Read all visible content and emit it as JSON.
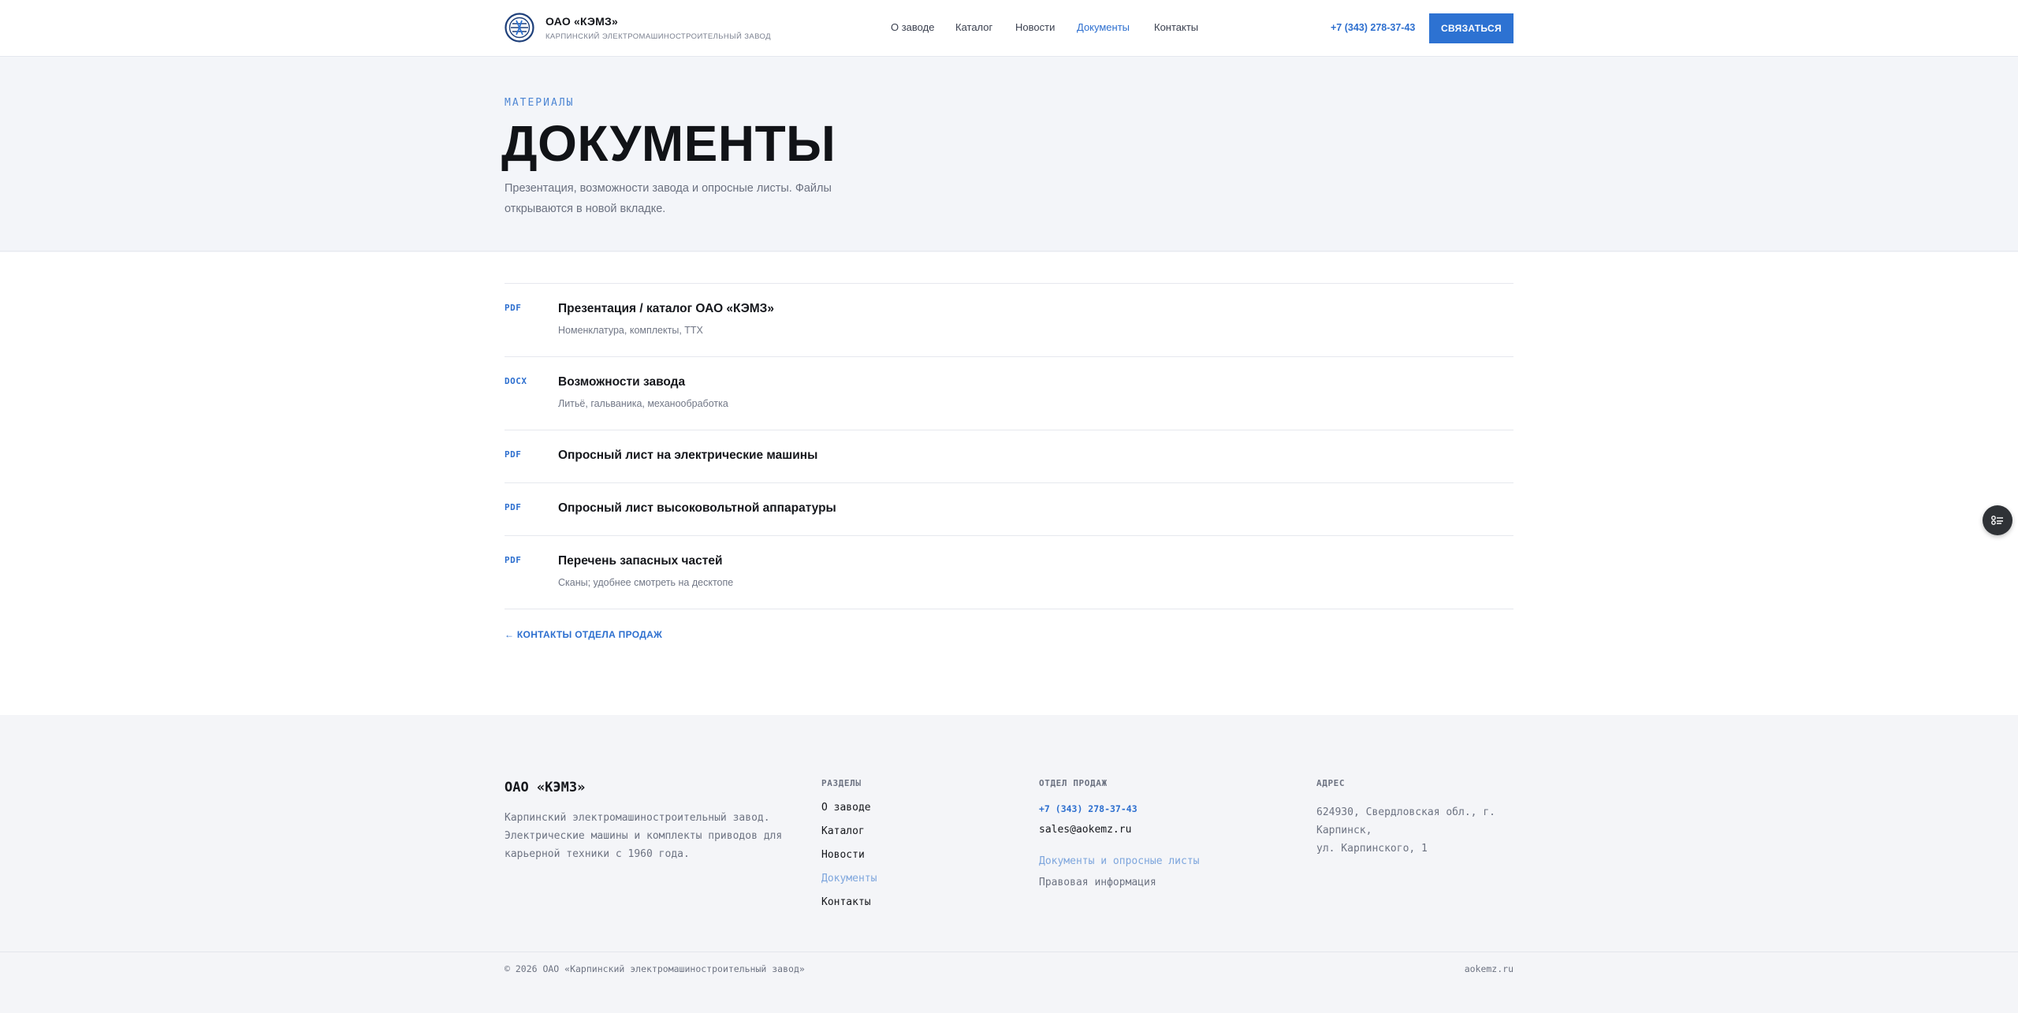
{
  "header": {
    "brand_name": "ОАО «КЭМЗ»",
    "brand_sub": "Карпинский электромашиностроительный завод",
    "nav": [
      {
        "label": "О заводе",
        "active": false
      },
      {
        "label": "Каталог",
        "active": false
      },
      {
        "label": "Новости",
        "active": false
      },
      {
        "label": "Документы",
        "active": true
      },
      {
        "label": "Контакты",
        "active": false
      }
    ],
    "phone": "+7 (343) 278-37-43",
    "cta_label": "Связаться",
    "logo_icon": "factory-logo-icon"
  },
  "hero": {
    "eyebrow": "Материалы",
    "title": "ДОКУМЕНТЫ",
    "lead": "Презентация, возможности завода и опросные листы. Файлы открываются в новой вкладке."
  },
  "documents": [
    {
      "type": "PDF",
      "title": "Презентация / каталог ОАО «КЭМЗ»",
      "desc": "Номенклатура, комплекты, ТТХ"
    },
    {
      "type": "DOCX",
      "title": "Возможности завода",
      "desc": "Литьё, гальваника, механообработка"
    },
    {
      "type": "PDF",
      "title": "Опросный лист на электрические машины",
      "desc": ""
    },
    {
      "type": "PDF",
      "title": "Опросный лист высоковольтной аппаратуры",
      "desc": ""
    },
    {
      "type": "PDF",
      "title": "Перечень запасных частей",
      "desc": "Сканы; удобнее смотреть на десктопе"
    }
  ],
  "back_link": "← Контакты отдела продаж",
  "floating_button_icon": "settings-sliders-icon",
  "footer": {
    "brand": "ОАО «КЭМЗ»",
    "about": "Карпинский электромашиностроительный завод. Электрические машины и комплекты приводов для карьерной техники с 1960 года.",
    "sections_title": "Разделы",
    "sections": [
      {
        "label": "О заводе",
        "active": false
      },
      {
        "label": "Каталог",
        "active": false
      },
      {
        "label": "Новости",
        "active": false
      },
      {
        "label": "Документы",
        "active": true
      },
      {
        "label": "Контакты",
        "active": false
      }
    ],
    "sales_title": "Отдел продаж",
    "sales_phone": "+7 (343) 278-37-43",
    "sales_email": "sales@aokemz.ru",
    "docs_link": "Документы и опросные листы",
    "legal_link": "Правовая информация",
    "address_title": "Адрес",
    "address_line1": "624930, Свердловская обл., г. Карпинск,",
    "address_line2": "ул. Карпинского, 1",
    "copyright": "© 2026 ОАО «Карпинский электромашиностроительный завод»",
    "domain": "aokemz.ru"
  },
  "colors": {
    "accent": "#2d72d2",
    "link_muted": "#7ea6dd",
    "text_dark": "#15171c",
    "text_muted": "#6d7382"
  }
}
